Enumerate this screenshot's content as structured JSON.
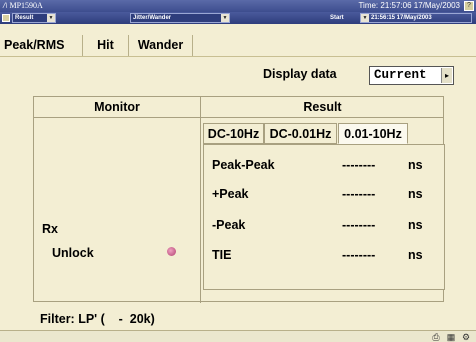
{
  "titlebar": {
    "app": "MP1590A",
    "time": "Time: 21:57:06 17/May/2003",
    "mini_icon": "?"
  },
  "toolbar": {
    "mode": "Result",
    "measure": "Jitter/Wander",
    "start": "Start",
    "start_time": "21:56:15 17/May/2003"
  },
  "tabs": [
    {
      "label": "Peak/RMS"
    },
    {
      "label": "Hit"
    },
    {
      "label": "Wander"
    }
  ],
  "display": {
    "label": "Display data",
    "value": "Current",
    "arrow": "▸"
  },
  "panel": {
    "monitor_header": "Monitor",
    "result_header": "Result"
  },
  "filter_tabs": [
    {
      "label": "DC-10Hz"
    },
    {
      "label": "DC-0.01Hz"
    },
    {
      "label": "0.01-10Hz"
    }
  ],
  "results": [
    {
      "label": "Peak-Peak",
      "value": "--------",
      "unit": "ns"
    },
    {
      "label": "+Peak",
      "value": "--------",
      "unit": "ns"
    },
    {
      "label": "-Peak",
      "value": "--------",
      "unit": "ns"
    },
    {
      "label": "TIE",
      "value": "--------",
      "unit": "ns"
    }
  ],
  "monitor": {
    "rx": "Rx",
    "unlock": "Unlock",
    "led_color": "#c8508a"
  },
  "filter": "Filter: LP' (    -  20k)",
  "colors": {
    "background": "#f3eed3",
    "titlebar": "#3d4d8e"
  }
}
